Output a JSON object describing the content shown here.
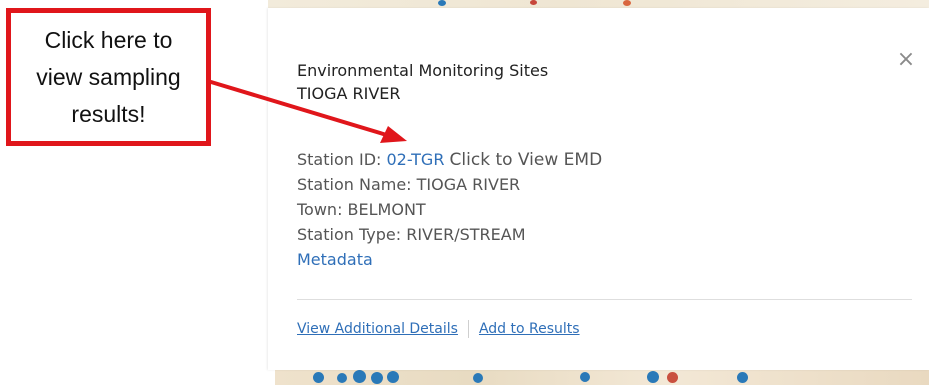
{
  "annotation": {
    "text": "Click here to\nview sampling\nresults!",
    "color": "#e0161b"
  },
  "popup": {
    "title": "Environmental Monitoring Sites",
    "subtitle": "TIOGA RIVER",
    "close_icon": "×",
    "fields": {
      "station_id_label": "Station ID: ",
      "station_id_value": "02-TGR",
      "station_id_action": "Click to View EMD",
      "station_name": "Station Name: TIOGA RIVER",
      "town": "Town: BELMONT",
      "station_type": "Station Type: RIVER/STREAM",
      "metadata_link": "Metadata"
    },
    "actions": {
      "view_details": "View Additional Details",
      "add_results": "Add to Results"
    },
    "colors": {
      "link": "#2f6fb8",
      "text": "#555555"
    }
  }
}
